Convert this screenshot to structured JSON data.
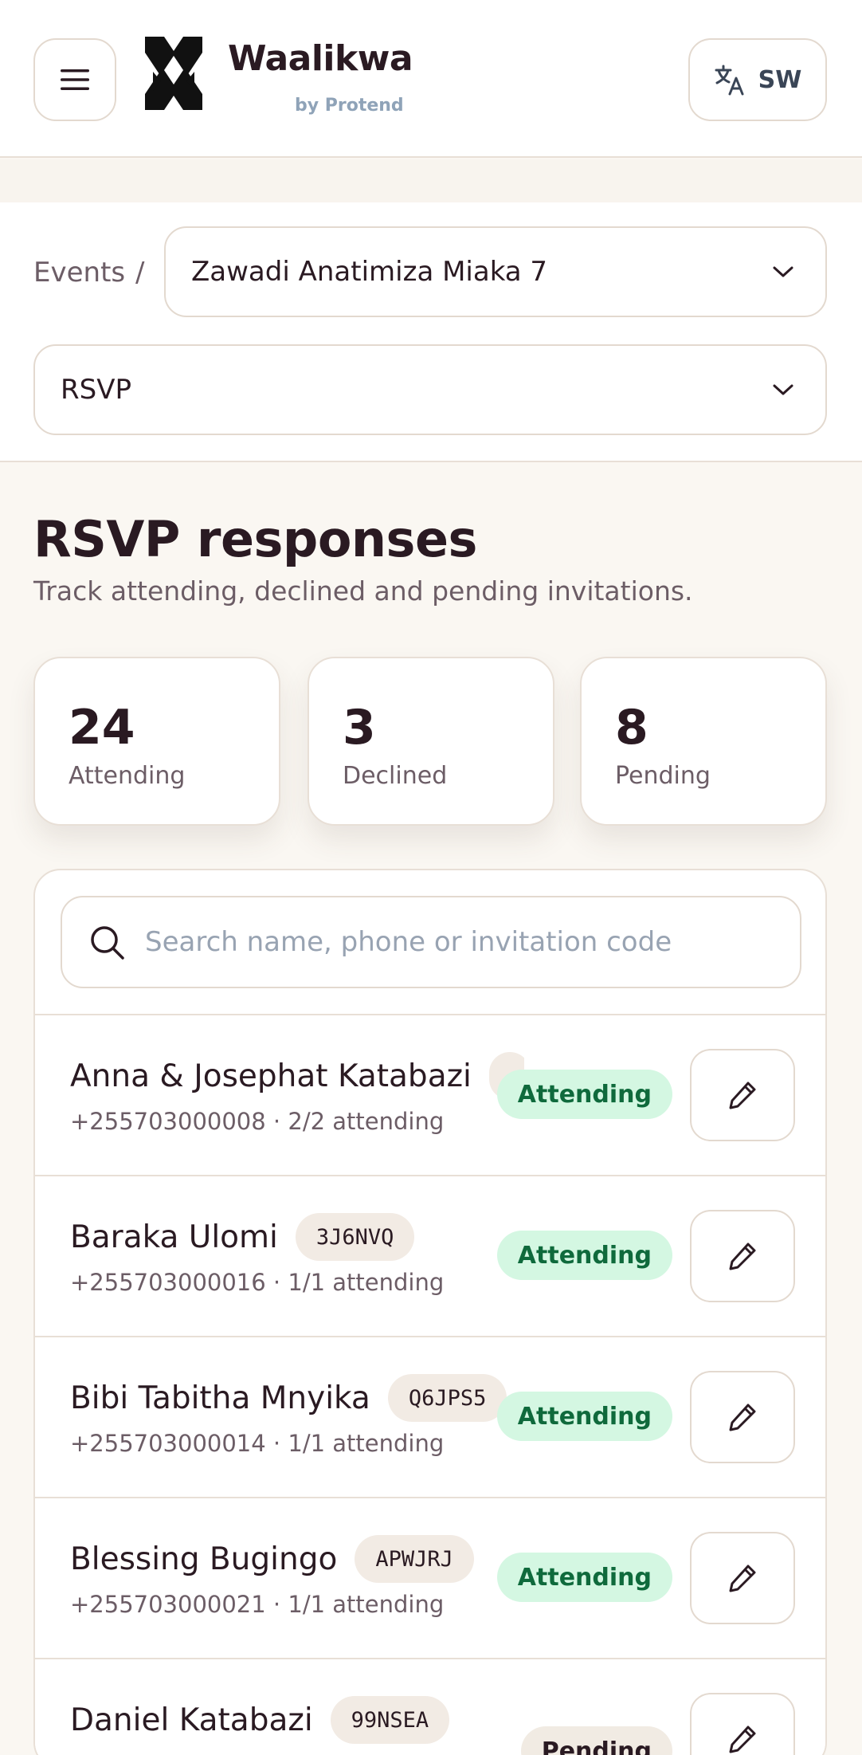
{
  "header": {
    "brand_name": "Waalikwa",
    "brand_sub": "by Protend",
    "language_code": "SW",
    "icons": {
      "menu": "hamburger-menu-icon",
      "language": "translate-icon"
    }
  },
  "breadcrumb": {
    "events_label": "Events",
    "separator": "/",
    "selected_event": "Zawadi Anatimiza Miaka 7"
  },
  "page_select": {
    "value": "RSVP"
  },
  "main": {
    "title": "RSVP responses",
    "subtitle": "Track attending, declined and pending invitations."
  },
  "stats": [
    {
      "value": "24",
      "label": "Attending"
    },
    {
      "value": "3",
      "label": "Declined"
    },
    {
      "value": "8",
      "label": "Pending"
    }
  ],
  "search": {
    "placeholder": "Search name, phone or invitation code"
  },
  "guests": [
    {
      "name": "Anna & Josephat Katabazi",
      "code": "",
      "phone": "+255703000008",
      "attending": "2/2 attending",
      "status": "Attending"
    },
    {
      "name": "Baraka Ulomi",
      "code": "3J6NVQ",
      "phone": "+255703000016",
      "attending": "1/1 attending",
      "status": "Attending"
    },
    {
      "name": "Bibi Tabitha Mnyika",
      "code": "Q6JPS5",
      "phone": "+255703000014",
      "attending": "1/1 attending",
      "status": "Attending"
    },
    {
      "name": "Blessing Bugingo",
      "code": "APWJRJ",
      "phone": "+255703000021",
      "attending": "1/1 attending",
      "status": "Attending"
    },
    {
      "name": "Daniel Katabazi",
      "code": "99NSEA",
      "phone": "",
      "attending": "",
      "status": "Pending"
    }
  ],
  "colors": {
    "background": "#faf7f2",
    "attending_badge_bg": "#d4f7e2",
    "attending_badge_text": "#0f6a3c",
    "pending_badge_bg": "#f1ebe3",
    "border": "#e3d9cf"
  }
}
